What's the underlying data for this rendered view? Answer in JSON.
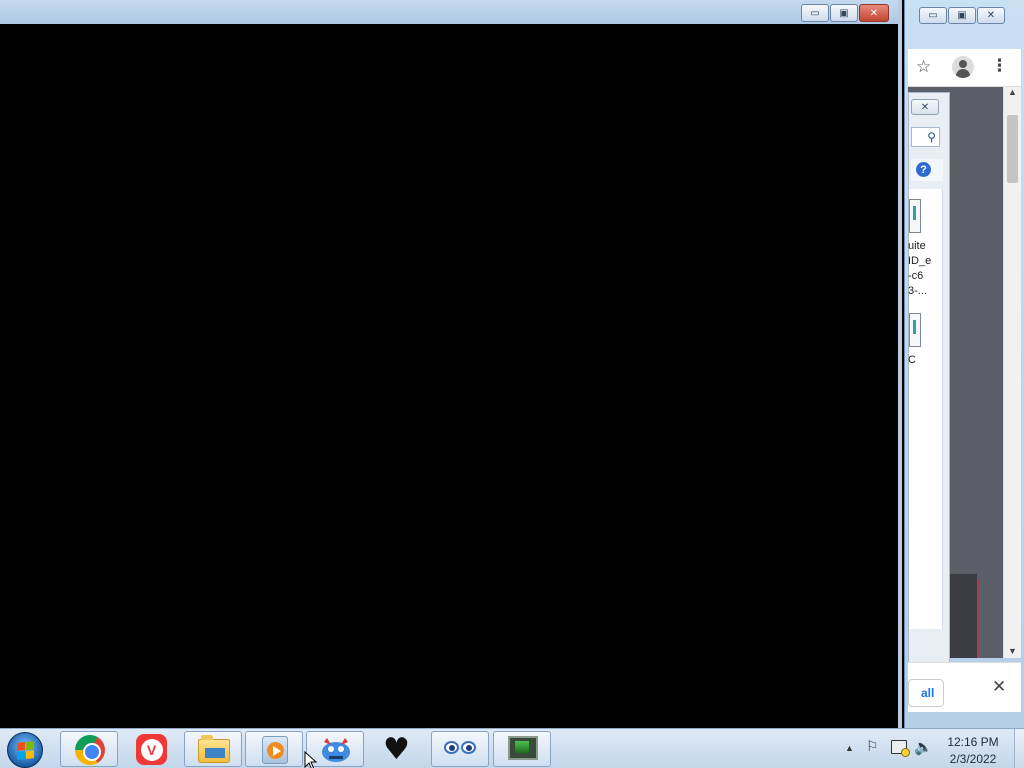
{
  "background_window": {
    "caption_buttons": {
      "minimize": "▭",
      "maximize": "▣",
      "close": "✕"
    },
    "panel": {
      "close_label": "✕",
      "search_icon": "⚲",
      "help_label": "?",
      "items": [
        {
          "label": "uite\nID_e\n-c6\n3-..."
        },
        {
          "label": "C"
        }
      ]
    },
    "download_bar": {
      "show_all_label": "all",
      "close_label": "✕"
    }
  },
  "foreground_window": {
    "caption_buttons": {
      "minimize": "▭",
      "maximize": "▣",
      "close": "✕"
    }
  },
  "taskbar": {
    "apps": [
      {
        "name": "Google Chrome",
        "icon": "chrome-icon"
      },
      {
        "name": "Vivaldi",
        "icon": "vivaldi-icon"
      },
      {
        "name": "Windows Explorer",
        "icon": "folder-icon"
      },
      {
        "name": "Windows Media Player",
        "icon": "media-icon"
      },
      {
        "name": "Game",
        "icon": "game-icon"
      },
      {
        "name": "Heart App",
        "icon": "heart-icon"
      },
      {
        "name": "Eyes App",
        "icon": "eyes-icon"
      },
      {
        "name": "Monitor App",
        "icon": "monitor-icon"
      }
    ],
    "clock": {
      "time": "12:16 PM",
      "date": "2/3/2022"
    }
  }
}
